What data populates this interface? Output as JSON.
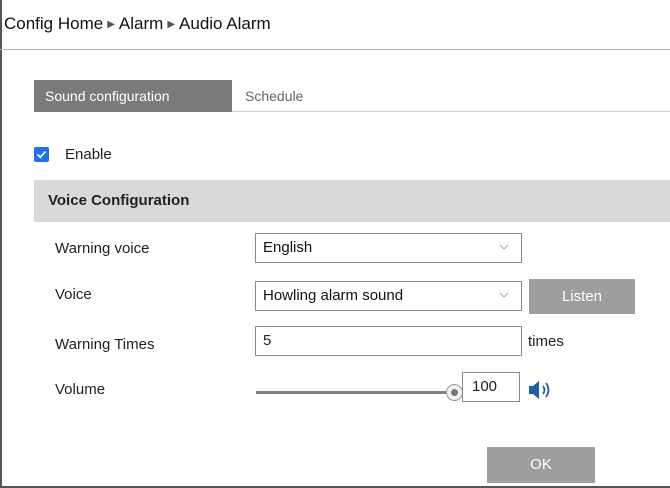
{
  "breadcrumb": {
    "items": [
      "Config Home",
      "Alarm",
      "Audio Alarm"
    ]
  },
  "tabs": [
    {
      "label": "Sound configuration",
      "active": true
    },
    {
      "label": "Schedule",
      "active": false
    }
  ],
  "enable": {
    "label": "Enable",
    "checked": true
  },
  "section": {
    "title": "Voice Configuration"
  },
  "form": {
    "warning_voice": {
      "label": "Warning voice",
      "value": "English"
    },
    "voice": {
      "label": "Voice",
      "value": "Howling alarm sound",
      "listen_label": "Listen"
    },
    "warning_times": {
      "label": "Warning Times",
      "value": "5",
      "unit": "times"
    },
    "volume": {
      "label": "Volume",
      "value": "100",
      "level_percent": 100
    }
  },
  "ok_label": "OK",
  "colors": {
    "accent": "#1a73e8",
    "tab_active_bg": "#7a7a7a",
    "button_bg": "#9e9e9e",
    "section_bg": "#d9d9d9",
    "speaker": "#1f5fa8"
  },
  "icons": {
    "breadcrumb_separator": "triangle-right-icon",
    "dropdown": "chevron-down-icon",
    "checkbox": "checkmark-icon",
    "volume": "speaker-icon"
  }
}
